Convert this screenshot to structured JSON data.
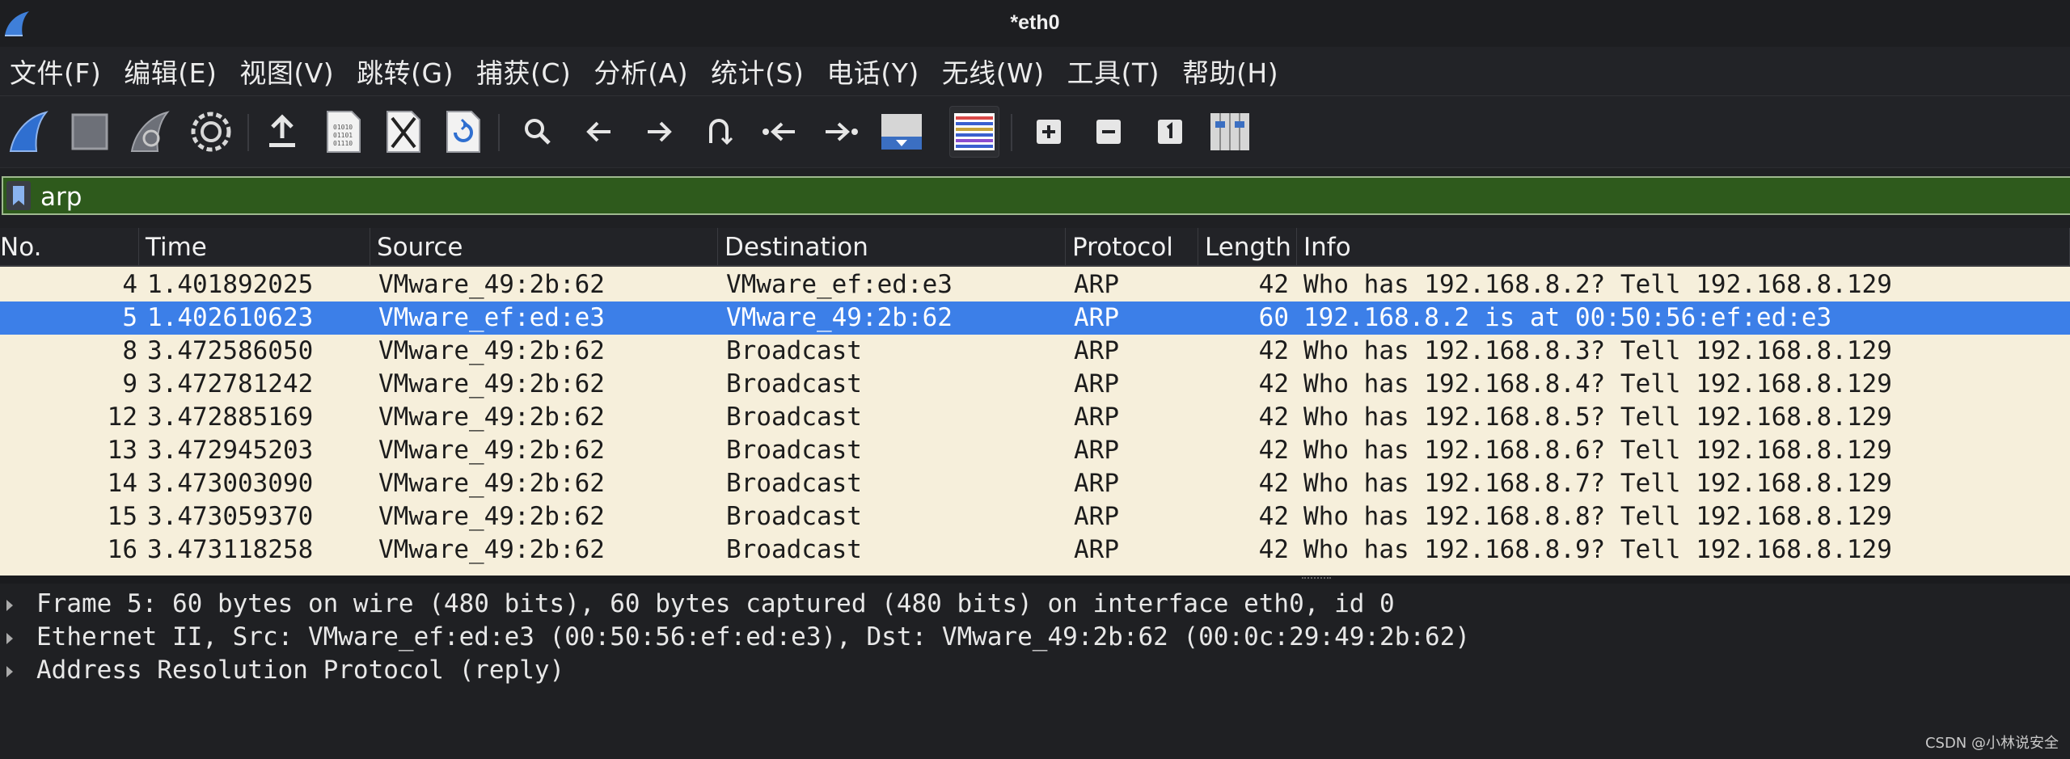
{
  "window": {
    "title": "*eth0"
  },
  "menu": [
    "文件(F)",
    "编辑(E)",
    "视图(V)",
    "跳转(G)",
    "捕获(C)",
    "分析(A)",
    "统计(S)",
    "电话(Y)",
    "无线(W)",
    "工具(T)",
    "帮助(H)"
  ],
  "toolbar": {
    "buttons": [
      {
        "icon": "shark-fin-start-icon"
      },
      {
        "icon": "stop-icon"
      },
      {
        "icon": "restart-capture-icon"
      },
      {
        "icon": "capture-options-gear-icon"
      },
      {
        "icon": "open-file-icon"
      },
      {
        "icon": "save-file-icon"
      },
      {
        "icon": "close-file-icon"
      },
      {
        "icon": "reload-file-icon"
      },
      {
        "icon": "find-packet-icon"
      },
      {
        "icon": "go-back-icon"
      },
      {
        "icon": "go-forward-icon"
      },
      {
        "icon": "go-to-packet-icon"
      },
      {
        "icon": "first-packet-icon"
      },
      {
        "icon": "last-packet-icon"
      },
      {
        "icon": "auto-scroll-icon"
      },
      {
        "icon": "colorize-icon"
      },
      {
        "icon": "zoom-in-icon"
      },
      {
        "icon": "zoom-out-icon"
      },
      {
        "icon": "normal-size-icon"
      },
      {
        "icon": "resize-columns-icon"
      }
    ]
  },
  "filter": {
    "value": "arp"
  },
  "columns": [
    "No.",
    "Time",
    "Source",
    "Destination",
    "Protocol",
    "Length",
    "Info"
  ],
  "packets": [
    {
      "no": "4",
      "time": "1.401892025",
      "source": "VMware_49:2b:62",
      "destination": "VMware_ef:ed:e3",
      "protocol": "ARP",
      "length": "42",
      "info": "Who has 192.168.8.2? Tell 192.168.8.129"
    },
    {
      "no": "5",
      "time": "1.402610623",
      "source": "VMware_ef:ed:e3",
      "destination": "VMware_49:2b:62",
      "protocol": "ARP",
      "length": "60",
      "info": "192.168.8.2 is at 00:50:56:ef:ed:e3"
    },
    {
      "no": "8",
      "time": "3.472586050",
      "source": "VMware_49:2b:62",
      "destination": "Broadcast",
      "protocol": "ARP",
      "length": "42",
      "info": "Who has 192.168.8.3? Tell 192.168.8.129"
    },
    {
      "no": "9",
      "time": "3.472781242",
      "source": "VMware_49:2b:62",
      "destination": "Broadcast",
      "protocol": "ARP",
      "length": "42",
      "info": "Who has 192.168.8.4? Tell 192.168.8.129"
    },
    {
      "no": "12",
      "time": "3.472885169",
      "source": "VMware_49:2b:62",
      "destination": "Broadcast",
      "protocol": "ARP",
      "length": "42",
      "info": "Who has 192.168.8.5? Tell 192.168.8.129"
    },
    {
      "no": "13",
      "time": "3.472945203",
      "source": "VMware_49:2b:62",
      "destination": "Broadcast",
      "protocol": "ARP",
      "length": "42",
      "info": "Who has 192.168.8.6? Tell 192.168.8.129"
    },
    {
      "no": "14",
      "time": "3.473003090",
      "source": "VMware_49:2b:62",
      "destination": "Broadcast",
      "protocol": "ARP",
      "length": "42",
      "info": "Who has 192.168.8.7? Tell 192.168.8.129"
    },
    {
      "no": "15",
      "time": "3.473059370",
      "source": "VMware_49:2b:62",
      "destination": "Broadcast",
      "protocol": "ARP",
      "length": "42",
      "info": "Who has 192.168.8.8? Tell 192.168.8.129"
    },
    {
      "no": "16",
      "time": "3.473118258",
      "source": "VMware_49:2b:62",
      "destination": "Broadcast",
      "protocol": "ARP",
      "length": "42",
      "info": "Who has 192.168.8.9? Tell 192.168.8.129"
    }
  ],
  "selected_packet_no": "5",
  "details": [
    "Frame 5: 60 bytes on wire (480 bits), 60 bytes captured (480 bits) on interface eth0, id 0",
    "Ethernet II, Src: VMware_ef:ed:e3 (00:50:56:ef:ed:e3), Dst: VMware_49:2b:62 (00:0c:29:49:2b:62)",
    "Address Resolution Protocol (reply)"
  ],
  "watermark": "CSDN @小林说安全",
  "colors": {
    "filter_valid_bg": "#2e5a1c",
    "selected_row": "#3c7fe8",
    "packet_list_bg": "#f6efdb",
    "window_bg": "#1f2023"
  }
}
